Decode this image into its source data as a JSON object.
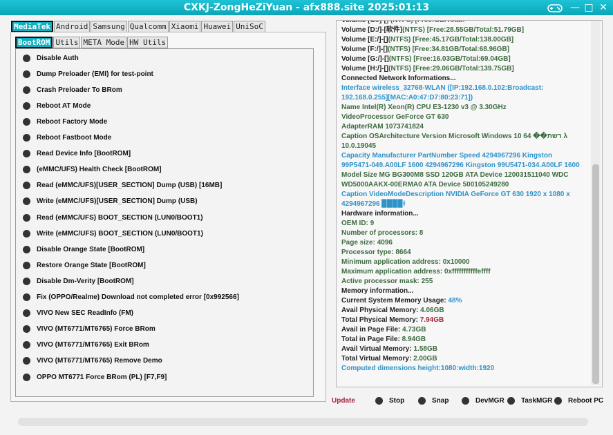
{
  "window": {
    "title": "CXKJ-ZongHeZiYuan - afx888.site 2025:01:13",
    "icon": "gamepad-icon",
    "minimize_glyph": "—",
    "maximize_glyph": "□",
    "close_glyph": "✕"
  },
  "brand_tabs": [
    {
      "label": "MediaTek",
      "active": true
    },
    {
      "label": "Android",
      "active": false
    },
    {
      "label": "Samsung",
      "active": false
    },
    {
      "label": "Qualcomm",
      "active": false
    },
    {
      "label": "Xiaomi",
      "active": false
    },
    {
      "label": "Huawei",
      "active": false
    },
    {
      "label": "UniSoC",
      "active": false
    }
  ],
  "sub_tabs": [
    {
      "label": "BootROM",
      "active": true
    },
    {
      "label": "Utils",
      "active": false
    },
    {
      "label": "META Mode",
      "active": false
    },
    {
      "label": "HW Utils",
      "active": false
    }
  ],
  "operations": [
    "Disable Auth",
    "Dump Preloader (EMI) for test-point",
    "Crash Preloader To BRom",
    "Reboot AT Mode",
    "Reboot Factory Mode",
    "Reboot Fastboot Mode",
    "Read Device Info [BootROM]",
    "(eMMC/UFS) Health Check [BootROM]",
    "Read (eMMC/UFS)[USER_SECTION] Dump (USB) [16MB]",
    "Write (eMMC/UFS)[USER_SECTION] Dump (USB)",
    "Read (eMMC/UFS) BOOT_SECTION (LUN0/BOOT1)",
    "Write (eMMC/UFS) BOOT_SECTION (LUN0/BOOT1)",
    "Disable Orange State [BootROM]",
    "Restore Orange State [BootROM]",
    "Disable Dm-Verity [BootROM]",
    "Fix (OPPO/Realme) Download not completed error [0x992566]",
    "VIVO New SEC ReadInfo (FM)",
    "VIVO (MT6771/MT6765) Force BRom",
    "VIVO (MT6771/MT6765) Exit BRom",
    "VIVO (MT6771/MT6765) Remove Demo",
    "OPPO MT6771 Force BRom (PL) [F7,F9]"
  ],
  "log_lines": [
    {
      "parts": [
        {
          "t": "Volume [C:/]-[",
          "c": "dark"
        },
        {
          "t": "] (NTFS) [Free:",
          "c": "green"
        },
        {
          "t": "GB/Total:",
          "c": "green"
        }
      ]
    },
    {
      "parts": [
        {
          "t": "Volume [D:/]-[软件]",
          "c": "dark"
        },
        {
          "t": "(NTFS) [Free:28.55GB/Total:51.79GB]",
          "c": "green"
        }
      ]
    },
    {
      "parts": [
        {
          "t": "Volume [E:/]-[]",
          "c": "dark"
        },
        {
          "t": "(NTFS) [Free:45.17GB/Total:138.00GB]",
          "c": "green"
        }
      ]
    },
    {
      "parts": [
        {
          "t": "Volume [F:/]-[]",
          "c": "dark"
        },
        {
          "t": "(NTFS) [Free:34.81GB/Total:68.96GB]",
          "c": "green"
        }
      ]
    },
    {
      "parts": [
        {
          "t": "Volume [G:/]-[]",
          "c": "dark"
        },
        {
          "t": "(NTFS) [Free:16.03GB/Total:69.04GB]",
          "c": "green"
        }
      ]
    },
    {
      "parts": [
        {
          "t": "Volume [H:/]-[]",
          "c": "dark"
        },
        {
          "t": "(NTFS) [Free:29.06GB/Total:139.75GB]",
          "c": "green"
        }
      ]
    },
    {
      "parts": [
        {
          "t": "Connected Network Informations...",
          "c": "dark"
        }
      ]
    },
    {
      "parts": [
        {
          "t": "Interface wireless_32768-WLAN ([IP:192.168.0.102:Broadcast:",
          "c": "blue"
        }
      ]
    },
    {
      "parts": [
        {
          "t": "192.168.0.255][MAC:A0:47:D7:80:23:71])",
          "c": "blue"
        }
      ]
    },
    {
      "parts": [
        {
          "t": "Name Intel(R) Xeon(R) CPU E3-1230 v3 @ 3.30GHz",
          "c": "green"
        }
      ]
    },
    {
      "parts": [
        {
          "t": "VideoProcessor GeForce GT 630",
          "c": "green"
        }
      ]
    },
    {
      "parts": [
        {
          "t": "AdapterRAM 1073741824",
          "c": "green"
        }
      ]
    },
    {
      "parts": [
        {
          "t": "Caption OSArchitecture Version Microsoft Windows 10 רשת�� 64 λ",
          "c": "green"
        }
      ]
    },
    {
      "parts": [
        {
          "t": "10.0.19045",
          "c": "green"
        }
      ]
    },
    {
      "parts": [
        {
          "t": "Capacity Manufacturer PartNumber Speed 4294967296 Kingston",
          "c": "blue"
        }
      ]
    },
    {
      "parts": [
        {
          "t": "99P5471-049.A00LF 1600 4294967296 Kingston 99U5471-034.A00LF 1600",
          "c": "blue"
        }
      ]
    },
    {
      "parts": [
        {
          "t": "Model Size MG BG300M8 SSD 120GB ATA Device 120031511040 WDC",
          "c": "green"
        }
      ]
    },
    {
      "parts": [
        {
          "t": "WD5000AAKX-00ERMA0 ATA Device 500105249280",
          "c": "green"
        }
      ]
    },
    {
      "parts": [
        {
          "t": "Caption VideoModeDescription NVIDIA GeForce GT 630 1920 x 1080 x",
          "c": "blue"
        }
      ]
    },
    {
      "parts": [
        {
          "t": "4294967296 ▉▉▉▉ɫ",
          "c": "blue"
        }
      ]
    },
    {
      "parts": [
        {
          "t": "Hardware information...",
          "c": "dark"
        }
      ]
    },
    {
      "parts": [
        {
          "t": "OEM ID: 9",
          "c": "green"
        }
      ]
    },
    {
      "parts": [
        {
          "t": "Number of processors: 8",
          "c": "green"
        }
      ]
    },
    {
      "parts": [
        {
          "t": "Page size: 4096",
          "c": "green"
        }
      ]
    },
    {
      "parts": [
        {
          "t": "Processor type: 8664",
          "c": "green"
        }
      ]
    },
    {
      "parts": [
        {
          "t": "Minimum application address: 0x10000",
          "c": "green"
        }
      ]
    },
    {
      "parts": [
        {
          "t": "Maximum application address: 0xfffffffffffeffff",
          "c": "green"
        }
      ]
    },
    {
      "parts": [
        {
          "t": "Active processor mask: 255",
          "c": "green"
        }
      ]
    },
    {
      "parts": [
        {
          "t": "Memory information...",
          "c": "dark"
        }
      ]
    },
    {
      "parts": [
        {
          "t": "Current System Memory Usage: ",
          "c": "dark"
        },
        {
          "t": "48%",
          "c": "blue"
        }
      ]
    },
    {
      "parts": [
        {
          "t": "Avail Physical Memory: ",
          "c": "dark"
        },
        {
          "t": "4.06GB",
          "c": "green"
        }
      ]
    },
    {
      "parts": [
        {
          "t": "Total Physical Memory: ",
          "c": "dark"
        },
        {
          "t": "7.94GB",
          "c": "red"
        }
      ]
    },
    {
      "parts": [
        {
          "t": "Avail in Page File: ",
          "c": "dark"
        },
        {
          "t": "4.73GB",
          "c": "green"
        }
      ]
    },
    {
      "parts": [
        {
          "t": "Total in Page File: ",
          "c": "dark"
        },
        {
          "t": "8.94GB",
          "c": "green"
        }
      ]
    },
    {
      "parts": [
        {
          "t": "Avail Virtual Memory: ",
          "c": "dark"
        },
        {
          "t": "1.58GB",
          "c": "green"
        }
      ]
    },
    {
      "parts": [
        {
          "t": "Total Virtual Memory: ",
          "c": "dark"
        },
        {
          "t": "2.00GB",
          "c": "green"
        }
      ]
    },
    {
      "parts": [
        {
          "t": "Computed dimensions height:1080:width:1920",
          "c": "blue"
        }
      ]
    }
  ],
  "bottom": {
    "update_label": "Update",
    "buttons": [
      "Stop",
      "Snap",
      "DevMGR",
      "TaskMGR",
      "Reboot PC"
    ]
  },
  "progress": {
    "value": 0.0
  },
  "colors": {
    "accent": "#13aebf",
    "log_green": "#3c6b3f",
    "log_blue": "#2e93c9",
    "log_red": "#a6243c",
    "update_link": "#a6243c"
  }
}
